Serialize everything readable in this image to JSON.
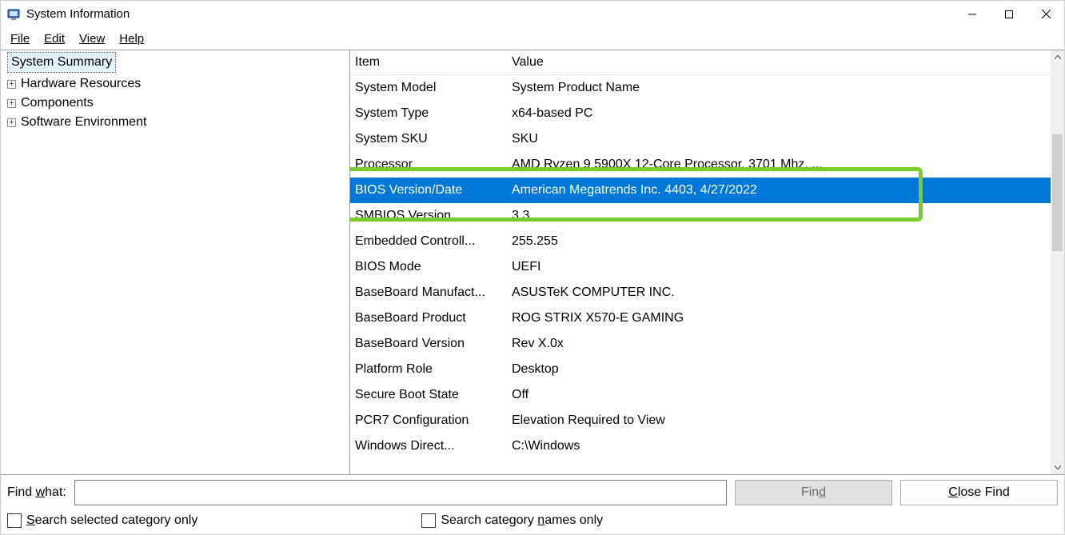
{
  "window": {
    "title": "System Information"
  },
  "menu": {
    "file": "File",
    "edit": "Edit",
    "view": "View",
    "help": "Help"
  },
  "tree": {
    "root": "System Summary",
    "nodes": [
      "Hardware Resources",
      "Components",
      "Software Environment"
    ]
  },
  "list": {
    "header_item": "Item",
    "header_value": "Value",
    "selected_index": 3,
    "rows": [
      {
        "item": "System Model",
        "value": "System Product Name"
      },
      {
        "item": "System Type",
        "value": "x64-based PC"
      },
      {
        "item": "System SKU",
        "value": "SKU"
      },
      {
        "item": "Processor",
        "value": "AMD Ryzen 9 5900X 12-Core Processor, 3701 Mhz, ..."
      },
      {
        "item": "BIOS Version/Date",
        "value": "American Megatrends Inc. 4403, 4/27/2022"
      },
      {
        "item": "SMBIOS Version",
        "value": "3.3"
      },
      {
        "item": "Embedded Controll...",
        "value": "255.255"
      },
      {
        "item": "BIOS Mode",
        "value": "UEFI"
      },
      {
        "item": "BaseBoard Manufact...",
        "value": "ASUSTeK COMPUTER INC."
      },
      {
        "item": "BaseBoard Product",
        "value": "ROG STRIX X570-E GAMING"
      },
      {
        "item": "BaseBoard Version",
        "value": "Rev X.0x"
      },
      {
        "item": "Platform Role",
        "value": "Desktop"
      },
      {
        "item": "Secure Boot State",
        "value": "Off"
      },
      {
        "item": "PCR7 Configuration",
        "value": "Elevation Required to View"
      },
      {
        "item": "Windows Direct...",
        "value": "C:\\Windows"
      }
    ]
  },
  "bottom": {
    "find_label_pre": "Find ",
    "find_label_ul": "w",
    "find_label_post": "hat:",
    "find_value": "",
    "find_btn_pre": "Fin",
    "find_btn_ul": "d",
    "close_btn_ul": "C",
    "close_btn_post": "lose Find",
    "chk1_ul": "S",
    "chk1_post": "earch selected category only",
    "chk2_pre": "Search category ",
    "chk2_ul": "n",
    "chk2_post": "ames only"
  },
  "highlight": {
    "selected_item": "BIOS Version/Date"
  }
}
